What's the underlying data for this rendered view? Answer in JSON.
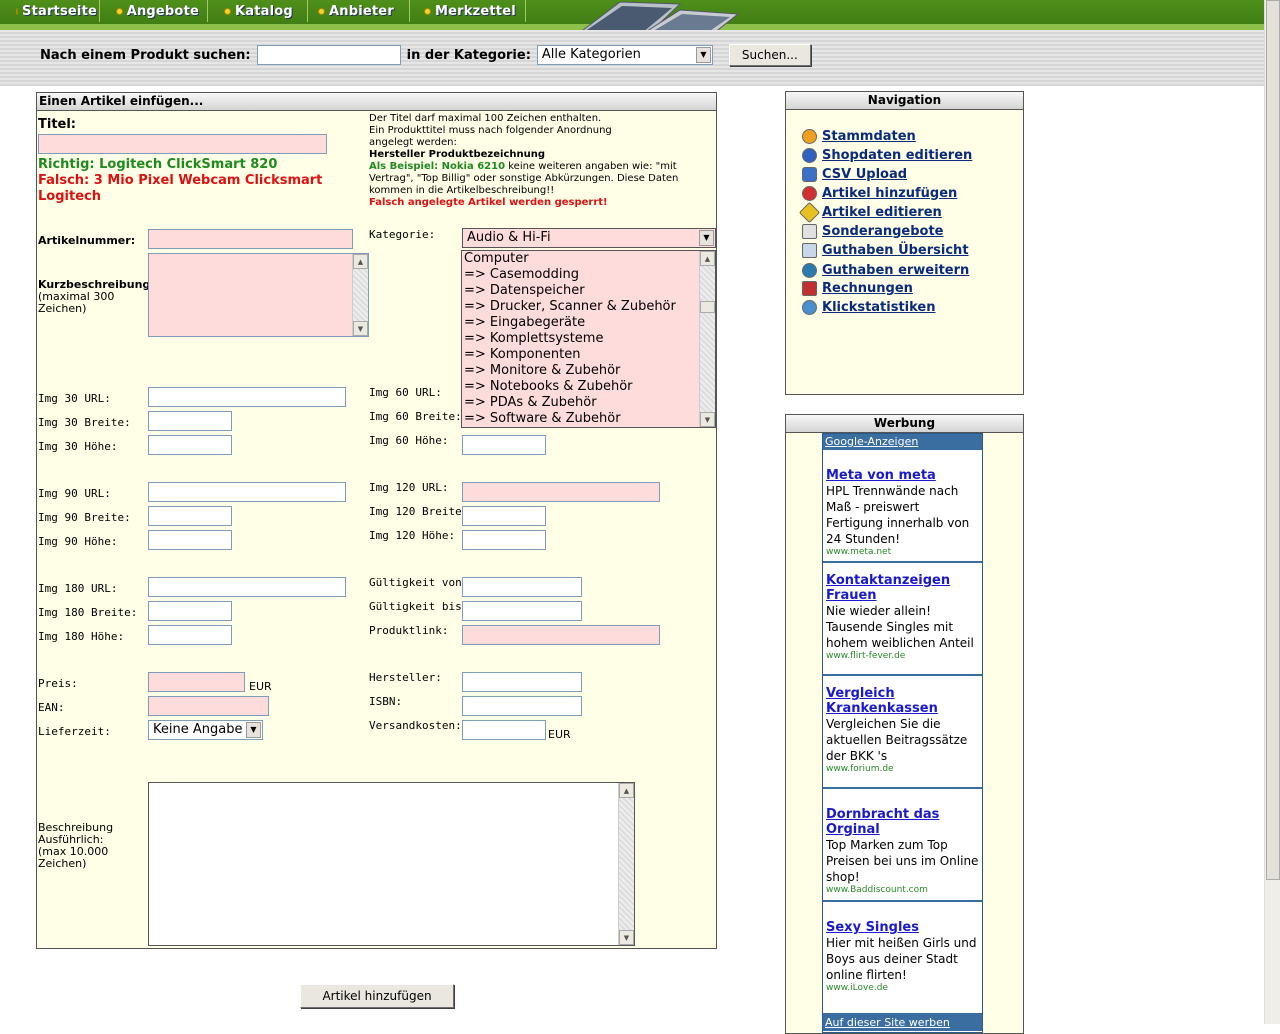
{
  "nav": {
    "tabs": [
      "Startseite",
      "Angebote",
      "Katalog",
      "Anbieter",
      "Merkzettel"
    ]
  },
  "search": {
    "label": "Nach einem Produkt suchen:",
    "value": "",
    "category_label": "in der Kategorie:",
    "category_selected": "Alle Kategorien",
    "button": "Suchen..."
  },
  "form": {
    "title": "Einen Artikel einfügen...",
    "titel_label": "Titel:",
    "hint": {
      "line1": "Der Titel darf maximal 100 Zeichen enthalten.",
      "line2": "Ein Produkttitel muss nach folgender Anordnung",
      "line3": "angelegt werden:",
      "format": "Hersteller Produktbezeichnung",
      "example_label": "Als Beispiel: Nokia 6210",
      "example_rest1": " keine weiteren angaben wie: \"mit",
      "example_rest2": "Vertrag\", \"Top Billig\" oder sonstige Abkürzungen. Diese Daten",
      "example_rest3": "kommen in die Artikelbeschreibung!!",
      "warning": "Falsch angelegte Artikel werden gesperrt!"
    },
    "richtig": "Richtig: Logitech ClickSmart 820",
    "falsch1": "Falsch: 3 Mio Pixel Webcam Clicksmart",
    "falsch2": "Logitech",
    "artikelnummer": "Artikelnummer:",
    "kurzbeschreibung": "Kurzbeschreibung:",
    "kurz_hint1": "(maximal 300",
    "kurz_hint2": "Zeichen)",
    "kategorie": "Kategorie:",
    "kategorie_selected": "Audio & Hi-Fi",
    "kategorie_options": [
      "Computer",
      "=> Casemodding",
      "=> Datenspeicher",
      "=> Drucker, Scanner & Zubehör",
      "=> Eingabegeräte",
      "=> Komplettsysteme",
      "=> Komponenten",
      "=> Monitore & Zubehör",
      "=> Notebooks & Zubehör",
      "=> PDAs & Zubehör",
      "=> Software & Zubehör"
    ],
    "img30_url": "Img 30  URL:",
    "img30_breite": "Img 30 Breite:",
    "img30_hoehe": "Img 30 Höhe:",
    "img60_url": "Img 60  URL:",
    "img60_breite": "Img 60 Breite:",
    "img60_hoehe": "Img 60 Höhe:",
    "img90_url": "Img 90  URL:",
    "img90_breite": "Img 90 Breite:",
    "img90_hoehe": "Img 90 Höhe:",
    "img120_url": "Img 120  URL:",
    "img120_breite": "Img 120 Breite:",
    "img120_hoehe": "Img 120 Höhe:",
    "img180_url": "Img 180  URL:",
    "img180_breite": "Img 180 Breite:",
    "img180_hoehe": "Img 180 Höhe:",
    "gueltig_von": "Gültigkeit von:",
    "gueltig_bis": "Gültigkeit bis:",
    "produktlink": "Produktlink:",
    "preis": "Preis:",
    "eur": "EUR",
    "ean": "EAN:",
    "lieferzeit": "Lieferzeit:",
    "lieferzeit_selected": "Keine Angabe",
    "hersteller": "Hersteller:",
    "isbn": "ISBN:",
    "versandkosten": "Versandkosten:",
    "beschreibung1": "Beschreibung",
    "beschreibung2": "Ausführlich:",
    "beschreibung3": "(max 10.000",
    "beschreibung4": "Zeichen)",
    "submit": "Artikel hinzufügen"
  },
  "sidebar": {
    "nav_title": "Navigation",
    "links": [
      "Stammdaten",
      "Shopdaten editieren",
      "CSV Upload",
      "Artikel hinzufügen",
      "Artikel editieren",
      "Sonderangebote",
      "Guthaben Übersicht",
      "Guthaben erweitern",
      "Rechnungen",
      "Klickstatistiken"
    ],
    "ads_title": "Werbung",
    "ads_header": "Google-Anzeigen",
    "ads": [
      {
        "title": "Meta von meta",
        "desc": "HPL Trennwände nach Maß - preiswert Fertigung innerhalb von 24 Stunden!",
        "url": "www.meta.net"
      },
      {
        "title": "Kontaktanzeigen Frauen",
        "desc": "Nie wieder allein! Tausende Singles mit hohem weiblichen Anteil",
        "url": "www.flirt-fever.de"
      },
      {
        "title": "Vergleich Krankenkassen",
        "desc": "Vergleichen Sie die aktuellen Beitragssätze der BKK 's",
        "url": "www.forium.de"
      },
      {
        "title": "Dornbracht das Orginal",
        "desc": "Top Marken zum Top Preisen bei uns im Online shop!",
        "url": "www.Baddiscount.com"
      },
      {
        "title": "Sexy Singles",
        "desc": "Hier mit heißen Girls und Boys aus deiner Stadt online flirten!",
        "url": "www.iLove.de"
      }
    ],
    "ads_footer": "Auf dieser Site werben"
  },
  "colors": {
    "nav_green": "#3d7a12",
    "panel_bg": "#ffffe8",
    "required_pink": "#ffdcdc",
    "ok_green": "#1f8a1f",
    "error_red": "#dd1111",
    "link_blue": "#0a2a7a"
  }
}
